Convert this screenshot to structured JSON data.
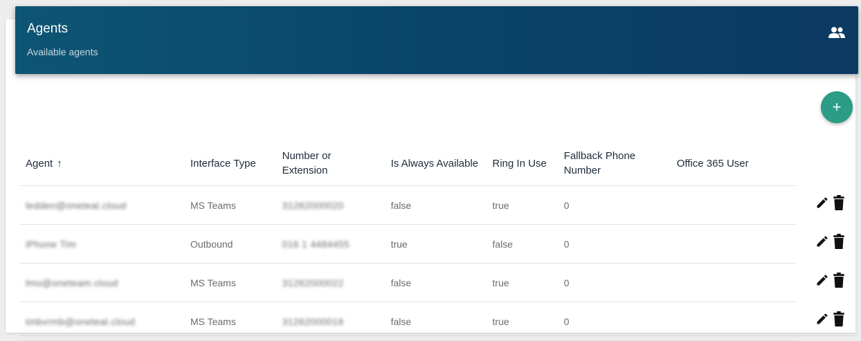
{
  "header": {
    "title": "Agents",
    "subtitle": "Available agents",
    "icon": "people-icon"
  },
  "add_button": {
    "label": "+",
    "icon": "plus-icon",
    "color": "#2b9c86"
  },
  "table": {
    "columns": [
      {
        "label": "Agent",
        "sort": "↑"
      },
      {
        "label": "Interface Type"
      },
      {
        "label": "Number or Extension"
      },
      {
        "label": "Is Always Available"
      },
      {
        "label": "Ring In Use"
      },
      {
        "label": "Fallback Phone Number"
      },
      {
        "label": "Office 365 User"
      }
    ],
    "rows": [
      {
        "agent": "ledden@oneteal.cloud",
        "interface": "MS Teams",
        "number": "31262000020",
        "always_available": "false",
        "ring_in_use": "true",
        "fallback": "0",
        "office365": ""
      },
      {
        "agent": "iPhone Tim",
        "interface": "Outbound",
        "number": "016 1 4484455",
        "always_available": "true",
        "ring_in_use": "false",
        "fallback": "0",
        "office365": ""
      },
      {
        "agent": "lmo@oneteam.cloud",
        "interface": "MS Teams",
        "number": "31262000022",
        "always_available": "false",
        "ring_in_use": "true",
        "fallback": "0",
        "office365": ""
      },
      {
        "agent": "tmbvrmb@oneteal.cloud",
        "interface": "MS Teams",
        "number": "31262000018",
        "always_available": "false",
        "ring_in_use": "true",
        "fallback": "0",
        "office365": ""
      }
    ]
  },
  "row_actions": {
    "edit_icon": "pencil-icon",
    "delete_icon": "trash-icon"
  },
  "colors": {
    "header_bg": "#0b4a6c",
    "accent": "#2b9c86"
  }
}
